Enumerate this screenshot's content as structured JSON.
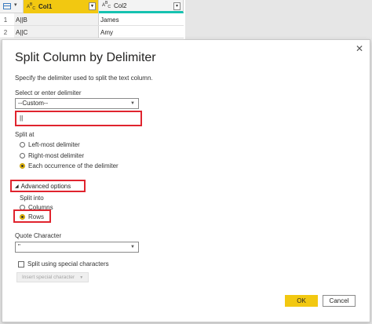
{
  "grid": {
    "columns": [
      {
        "type_icon": "ABC",
        "name": "Col1"
      },
      {
        "type_icon": "ABC",
        "name": "Col2"
      }
    ],
    "rows": [
      {
        "num": "1",
        "col1": "A||B",
        "col2": "James"
      },
      {
        "num": "2",
        "col1": "A||C",
        "col2": "Amy"
      }
    ],
    "accent": "#f2c811"
  },
  "dialog": {
    "title": "Split Column by Delimiter",
    "subtitle": "Specify the delimiter used to split the text column.",
    "delimiter_label": "Select or enter delimiter",
    "delimiter_selected": "--Custom--",
    "custom_value": "||",
    "split_at_label": "Split at",
    "split_at_options": [
      {
        "label": "Left-most delimiter",
        "selected": false
      },
      {
        "label": "Right-most delimiter",
        "selected": false
      },
      {
        "label": "Each occurrence of the delimiter",
        "selected": true
      }
    ],
    "advanced_label": "Advanced options",
    "split_into_label": "Split into",
    "split_into_options": [
      {
        "label": "Columns",
        "selected": false
      },
      {
        "label": "Rows",
        "selected": true
      }
    ],
    "quote_label": "Quote Character",
    "quote_value": "\"",
    "special_chars_label": "Split using special characters",
    "insert_special_label": "Insert special character",
    "ok_label": "OK",
    "cancel_label": "Cancel",
    "close_icon": "close-icon",
    "highlight_color": "#e0242e"
  }
}
